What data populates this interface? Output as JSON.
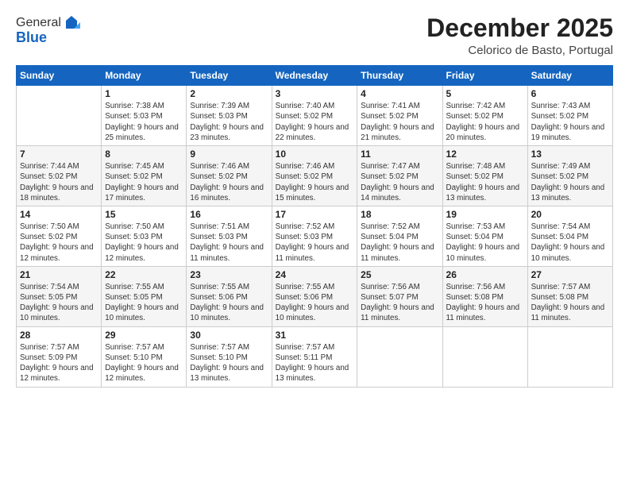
{
  "logo": {
    "general": "General",
    "blue": "Blue"
  },
  "header": {
    "month_title": "December 2025",
    "location": "Celorico de Basto, Portugal"
  },
  "days_of_week": [
    "Sunday",
    "Monday",
    "Tuesday",
    "Wednesday",
    "Thursday",
    "Friday",
    "Saturday"
  ],
  "weeks": [
    [
      {
        "day": "",
        "sunrise": "",
        "sunset": "",
        "daylight": ""
      },
      {
        "day": "1",
        "sunrise": "Sunrise: 7:38 AM",
        "sunset": "Sunset: 5:03 PM",
        "daylight": "Daylight: 9 hours and 25 minutes."
      },
      {
        "day": "2",
        "sunrise": "Sunrise: 7:39 AM",
        "sunset": "Sunset: 5:03 PM",
        "daylight": "Daylight: 9 hours and 23 minutes."
      },
      {
        "day": "3",
        "sunrise": "Sunrise: 7:40 AM",
        "sunset": "Sunset: 5:02 PM",
        "daylight": "Daylight: 9 hours and 22 minutes."
      },
      {
        "day": "4",
        "sunrise": "Sunrise: 7:41 AM",
        "sunset": "Sunset: 5:02 PM",
        "daylight": "Daylight: 9 hours and 21 minutes."
      },
      {
        "day": "5",
        "sunrise": "Sunrise: 7:42 AM",
        "sunset": "Sunset: 5:02 PM",
        "daylight": "Daylight: 9 hours and 20 minutes."
      },
      {
        "day": "6",
        "sunrise": "Sunrise: 7:43 AM",
        "sunset": "Sunset: 5:02 PM",
        "daylight": "Daylight: 9 hours and 19 minutes."
      }
    ],
    [
      {
        "day": "7",
        "sunrise": "Sunrise: 7:44 AM",
        "sunset": "Sunset: 5:02 PM",
        "daylight": "Daylight: 9 hours and 18 minutes."
      },
      {
        "day": "8",
        "sunrise": "Sunrise: 7:45 AM",
        "sunset": "Sunset: 5:02 PM",
        "daylight": "Daylight: 9 hours and 17 minutes."
      },
      {
        "day": "9",
        "sunrise": "Sunrise: 7:46 AM",
        "sunset": "Sunset: 5:02 PM",
        "daylight": "Daylight: 9 hours and 16 minutes."
      },
      {
        "day": "10",
        "sunrise": "Sunrise: 7:46 AM",
        "sunset": "Sunset: 5:02 PM",
        "daylight": "Daylight: 9 hours and 15 minutes."
      },
      {
        "day": "11",
        "sunrise": "Sunrise: 7:47 AM",
        "sunset": "Sunset: 5:02 PM",
        "daylight": "Daylight: 9 hours and 14 minutes."
      },
      {
        "day": "12",
        "sunrise": "Sunrise: 7:48 AM",
        "sunset": "Sunset: 5:02 PM",
        "daylight": "Daylight: 9 hours and 13 minutes."
      },
      {
        "day": "13",
        "sunrise": "Sunrise: 7:49 AM",
        "sunset": "Sunset: 5:02 PM",
        "daylight": "Daylight: 9 hours and 13 minutes."
      }
    ],
    [
      {
        "day": "14",
        "sunrise": "Sunrise: 7:50 AM",
        "sunset": "Sunset: 5:02 PM",
        "daylight": "Daylight: 9 hours and 12 minutes."
      },
      {
        "day": "15",
        "sunrise": "Sunrise: 7:50 AM",
        "sunset": "Sunset: 5:03 PM",
        "daylight": "Daylight: 9 hours and 12 minutes."
      },
      {
        "day": "16",
        "sunrise": "Sunrise: 7:51 AM",
        "sunset": "Sunset: 5:03 PM",
        "daylight": "Daylight: 9 hours and 11 minutes."
      },
      {
        "day": "17",
        "sunrise": "Sunrise: 7:52 AM",
        "sunset": "Sunset: 5:03 PM",
        "daylight": "Daylight: 9 hours and 11 minutes."
      },
      {
        "day": "18",
        "sunrise": "Sunrise: 7:52 AM",
        "sunset": "Sunset: 5:04 PM",
        "daylight": "Daylight: 9 hours and 11 minutes."
      },
      {
        "day": "19",
        "sunrise": "Sunrise: 7:53 AM",
        "sunset": "Sunset: 5:04 PM",
        "daylight": "Daylight: 9 hours and 10 minutes."
      },
      {
        "day": "20",
        "sunrise": "Sunrise: 7:54 AM",
        "sunset": "Sunset: 5:04 PM",
        "daylight": "Daylight: 9 hours and 10 minutes."
      }
    ],
    [
      {
        "day": "21",
        "sunrise": "Sunrise: 7:54 AM",
        "sunset": "Sunset: 5:05 PM",
        "daylight": "Daylight: 9 hours and 10 minutes."
      },
      {
        "day": "22",
        "sunrise": "Sunrise: 7:55 AM",
        "sunset": "Sunset: 5:05 PM",
        "daylight": "Daylight: 9 hours and 10 minutes."
      },
      {
        "day": "23",
        "sunrise": "Sunrise: 7:55 AM",
        "sunset": "Sunset: 5:06 PM",
        "daylight": "Daylight: 9 hours and 10 minutes."
      },
      {
        "day": "24",
        "sunrise": "Sunrise: 7:55 AM",
        "sunset": "Sunset: 5:06 PM",
        "daylight": "Daylight: 9 hours and 10 minutes."
      },
      {
        "day": "25",
        "sunrise": "Sunrise: 7:56 AM",
        "sunset": "Sunset: 5:07 PM",
        "daylight": "Daylight: 9 hours and 11 minutes."
      },
      {
        "day": "26",
        "sunrise": "Sunrise: 7:56 AM",
        "sunset": "Sunset: 5:08 PM",
        "daylight": "Daylight: 9 hours and 11 minutes."
      },
      {
        "day": "27",
        "sunrise": "Sunrise: 7:57 AM",
        "sunset": "Sunset: 5:08 PM",
        "daylight": "Daylight: 9 hours and 11 minutes."
      }
    ],
    [
      {
        "day": "28",
        "sunrise": "Sunrise: 7:57 AM",
        "sunset": "Sunset: 5:09 PM",
        "daylight": "Daylight: 9 hours and 12 minutes."
      },
      {
        "day": "29",
        "sunrise": "Sunrise: 7:57 AM",
        "sunset": "Sunset: 5:10 PM",
        "daylight": "Daylight: 9 hours and 12 minutes."
      },
      {
        "day": "30",
        "sunrise": "Sunrise: 7:57 AM",
        "sunset": "Sunset: 5:10 PM",
        "daylight": "Daylight: 9 hours and 13 minutes."
      },
      {
        "day": "31",
        "sunrise": "Sunrise: 7:57 AM",
        "sunset": "Sunset: 5:11 PM",
        "daylight": "Daylight: 9 hours and 13 minutes."
      },
      {
        "day": "",
        "sunrise": "",
        "sunset": "",
        "daylight": ""
      },
      {
        "day": "",
        "sunrise": "",
        "sunset": "",
        "daylight": ""
      },
      {
        "day": "",
        "sunrise": "",
        "sunset": "",
        "daylight": ""
      }
    ]
  ]
}
